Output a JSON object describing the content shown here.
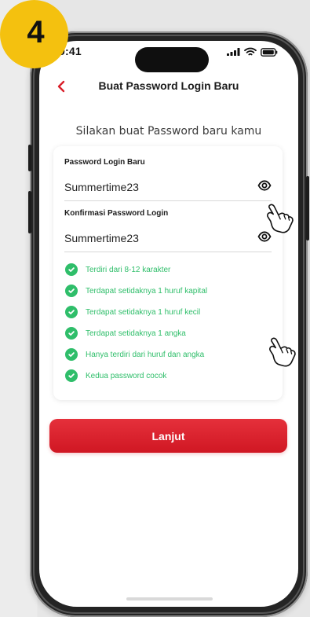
{
  "step_badge": {
    "number": "4",
    "color": "#F4C10F"
  },
  "status_bar": {
    "time": "9:41",
    "signal_icon": "signal-icon",
    "wifi_icon": "wifi-icon",
    "battery_icon": "battery-icon"
  },
  "header": {
    "title": "Buat Password Login Baru",
    "back_icon": "chevron-left-icon"
  },
  "subtitle": "Silakan buat Password baru kamu",
  "form": {
    "new_password": {
      "label": "Password Login Baru",
      "value": "Summertime23",
      "icon": "eye-icon"
    },
    "confirm_password": {
      "label": "Konfirmasi Password Login",
      "value": "Summertime23",
      "icon": "eye-icon"
    }
  },
  "requirements": [
    {
      "text": "Terdiri dari 8-12 karakter",
      "icon": "check-circle-icon"
    },
    {
      "text": "Terdapat setidaknya 1 huruf kapital",
      "icon": "check-circle-icon"
    },
    {
      "text": "Terdapat setidaknya 1 huruf kecil",
      "icon": "check-circle-icon"
    },
    {
      "text": "Terdapat setidaknya 1 angka",
      "icon": "check-circle-icon"
    },
    {
      "text": "Hanya terdiri dari huruf dan angka",
      "icon": "check-circle-icon"
    },
    {
      "text": "Kedua password cocok",
      "icon": "check-circle-icon"
    }
  ],
  "submit_button": {
    "label": "Lanjut",
    "color": "#D91F2A"
  },
  "colors": {
    "accent": "#D91F2A",
    "success": "#2FBE6A"
  }
}
